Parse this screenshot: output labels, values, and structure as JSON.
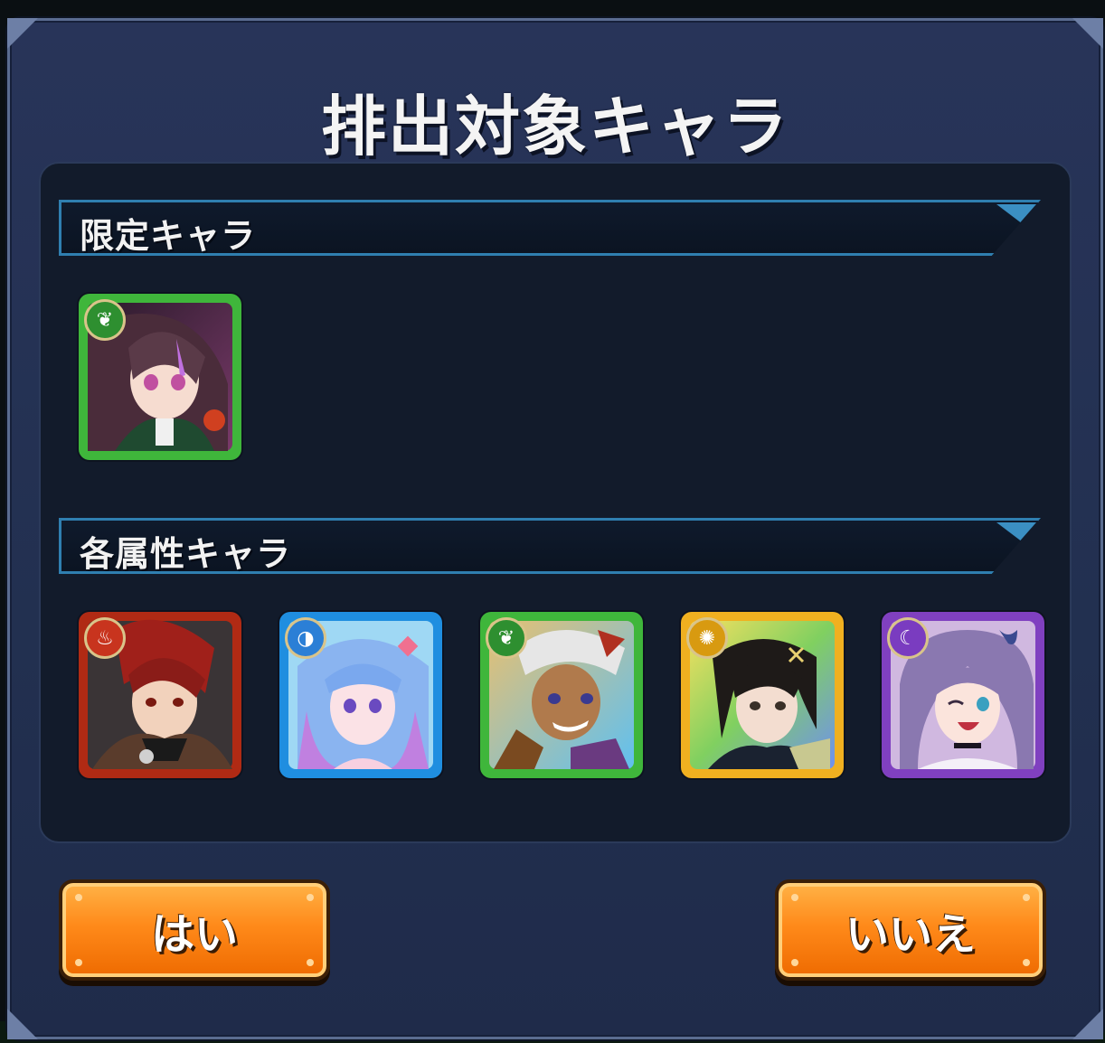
{
  "dialog": {
    "title": "排出対象キャラ",
    "sections": [
      {
        "label": "限定キャラ",
        "characters": [
          {
            "element": "wood",
            "element_icon": "leaf-icon",
            "frame_color": "#3fb63b"
          }
        ]
      },
      {
        "label": "各属性キャラ",
        "characters": [
          {
            "element": "fire",
            "element_icon": "flame-icon",
            "frame_color": "#e04020"
          },
          {
            "element": "water",
            "element_icon": "water-drop-icon",
            "frame_color": "#2a9ee6"
          },
          {
            "element": "wood",
            "element_icon": "leaf-icon",
            "frame_color": "#3fb63b"
          },
          {
            "element": "light",
            "element_icon": "sun-icon",
            "frame_color": "#f0b020"
          },
          {
            "element": "dark",
            "element_icon": "moon-icon",
            "frame_color": "#8040c0"
          }
        ]
      }
    ],
    "buttons": {
      "yes_label": "はい",
      "no_label": "いいえ"
    }
  }
}
